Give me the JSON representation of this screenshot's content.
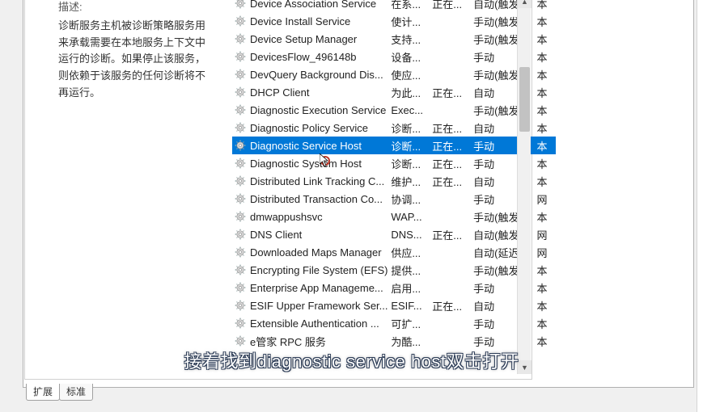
{
  "description": {
    "label": "描述:",
    "text": "诊断服务主机被诊断策略服务用来承载需要在本地服务上下文中运行的诊断。如果停止该服务，则依赖于该服务的任何诊断将不再运行。"
  },
  "services": [
    {
      "name": "Device Association Service",
      "desc": "在系...",
      "status": "正在...",
      "startup": "自动(触发...",
      "logon": "本"
    },
    {
      "name": "Device Install Service",
      "desc": "使计...",
      "status": "",
      "startup": "手动(触发...",
      "logon": "本"
    },
    {
      "name": "Device Setup Manager",
      "desc": "支持...",
      "status": "",
      "startup": "手动(触发...",
      "logon": "本"
    },
    {
      "name": "DevicesFlow_496148b",
      "desc": "设备...",
      "status": "",
      "startup": "手动",
      "logon": "本"
    },
    {
      "name": "DevQuery Background Dis...",
      "desc": "使应...",
      "status": "",
      "startup": "手动(触发...",
      "logon": "本"
    },
    {
      "name": "DHCP Client",
      "desc": "为此...",
      "status": "正在...",
      "startup": "自动",
      "logon": "本"
    },
    {
      "name": "Diagnostic Execution Service",
      "desc": "Exec...",
      "status": "",
      "startup": "手动(触发...",
      "logon": "本"
    },
    {
      "name": "Diagnostic Policy Service",
      "desc": "诊断...",
      "status": "正在...",
      "startup": "自动",
      "logon": "本"
    },
    {
      "name": "Diagnostic Service Host",
      "desc": "诊断...",
      "status": "正在...",
      "startup": "手动",
      "logon": "本",
      "selected": true
    },
    {
      "name": "Diagnostic System Host",
      "desc": "诊断...",
      "status": "正在...",
      "startup": "手动",
      "logon": "本"
    },
    {
      "name": "Distributed Link Tracking C...",
      "desc": "维护...",
      "status": "正在...",
      "startup": "自动",
      "logon": "本"
    },
    {
      "name": "Distributed Transaction Co...",
      "desc": "协调...",
      "status": "",
      "startup": "手动",
      "logon": "网"
    },
    {
      "name": "dmwappushsvc",
      "desc": "WAP...",
      "status": "",
      "startup": "手动(触发...",
      "logon": "本"
    },
    {
      "name": "DNS Client",
      "desc": "DNS...",
      "status": "正在...",
      "startup": "自动(触发...",
      "logon": "网"
    },
    {
      "name": "Downloaded Maps Manager",
      "desc": "供应...",
      "status": "",
      "startup": "自动(延迟...",
      "logon": "网"
    },
    {
      "name": "Encrypting File System (EFS)",
      "desc": "提供...",
      "status": "",
      "startup": "手动(触发...",
      "logon": "本"
    },
    {
      "name": "Enterprise App Manageme...",
      "desc": "启用...",
      "status": "",
      "startup": "手动",
      "logon": "本"
    },
    {
      "name": "ESIF Upper Framework Ser...",
      "desc": "ESIF...",
      "status": "正在...",
      "startup": "自动",
      "logon": "本"
    },
    {
      "name": "Extensible Authentication ...",
      "desc": "可扩...",
      "status": "",
      "startup": "手动",
      "logon": "本"
    },
    {
      "name": "e管家 RPC 服务",
      "desc": "为酷...",
      "status": "",
      "startup": "手动",
      "logon": "本"
    }
  ],
  "tabs": {
    "extended": "扩展",
    "standard": "标准"
  },
  "subtitle": "接着找到diagnostic service host双击打开"
}
